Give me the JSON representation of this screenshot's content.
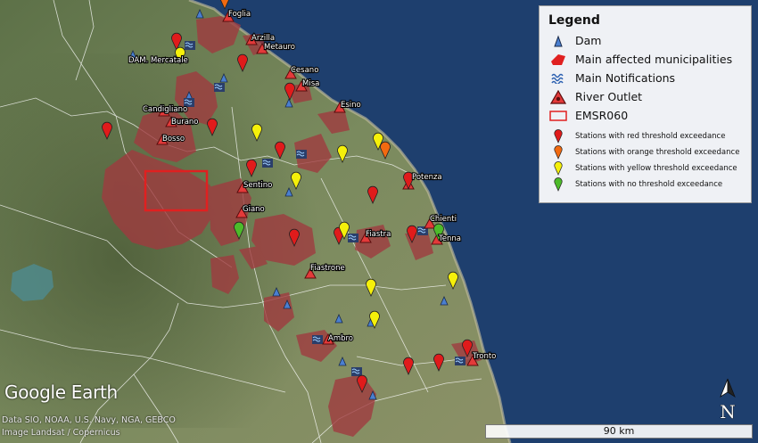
{
  "legend": {
    "title": "Legend",
    "items": [
      {
        "label": "Dam",
        "icon": "dam-icon"
      },
      {
        "label": "Main affected municipalities",
        "icon": "affected-municipality-icon"
      },
      {
        "label": "Main Notifications",
        "icon": "notification-icon"
      },
      {
        "label": "River Outlet",
        "icon": "river-outlet-icon"
      },
      {
        "label": "EMSR060",
        "icon": "emsr-rectangle-icon"
      }
    ],
    "stations": [
      {
        "label": "Stations with red threshold exceedance",
        "color": "#e01b1b"
      },
      {
        "label": "Stations with orange threshold exceedance",
        "color": "#f26a10"
      },
      {
        "label": "Stations with yellow threshold exceedance",
        "color": "#f5f00a"
      },
      {
        "label": "Stations with no threshold exceedance",
        "color": "#4dbb2a"
      }
    ]
  },
  "place_labels": [
    "Foglia",
    "Arzilla",
    "Metauro",
    "DAM. Mercatale",
    "Cesano",
    "Misa",
    "Esino",
    "Candigliano",
    "Burano",
    "Bosso",
    "Sentino",
    "Giano",
    "Potenza",
    "Chienti",
    "Fiastra",
    "Tenna",
    "Fiastrone",
    "Ambro",
    "Tronto"
  ],
  "watermark": "Google Earth",
  "credits": [
    "Data SIO, NOAA, U.S. Navy, NGA, GEBCO",
    "Image Landsat / Copernicus"
  ],
  "scale": "90 km",
  "north_label": "N",
  "colors": {
    "sea": "#1e3f6e",
    "land": "#6f8258",
    "affected": "#a03a3f",
    "red_station": "#e01b1b",
    "orange_station": "#f26a10",
    "yellow_station": "#f5f00a",
    "green_station": "#4dbb2a",
    "dam": "#4a7fd0",
    "emsr": "#e02020"
  }
}
